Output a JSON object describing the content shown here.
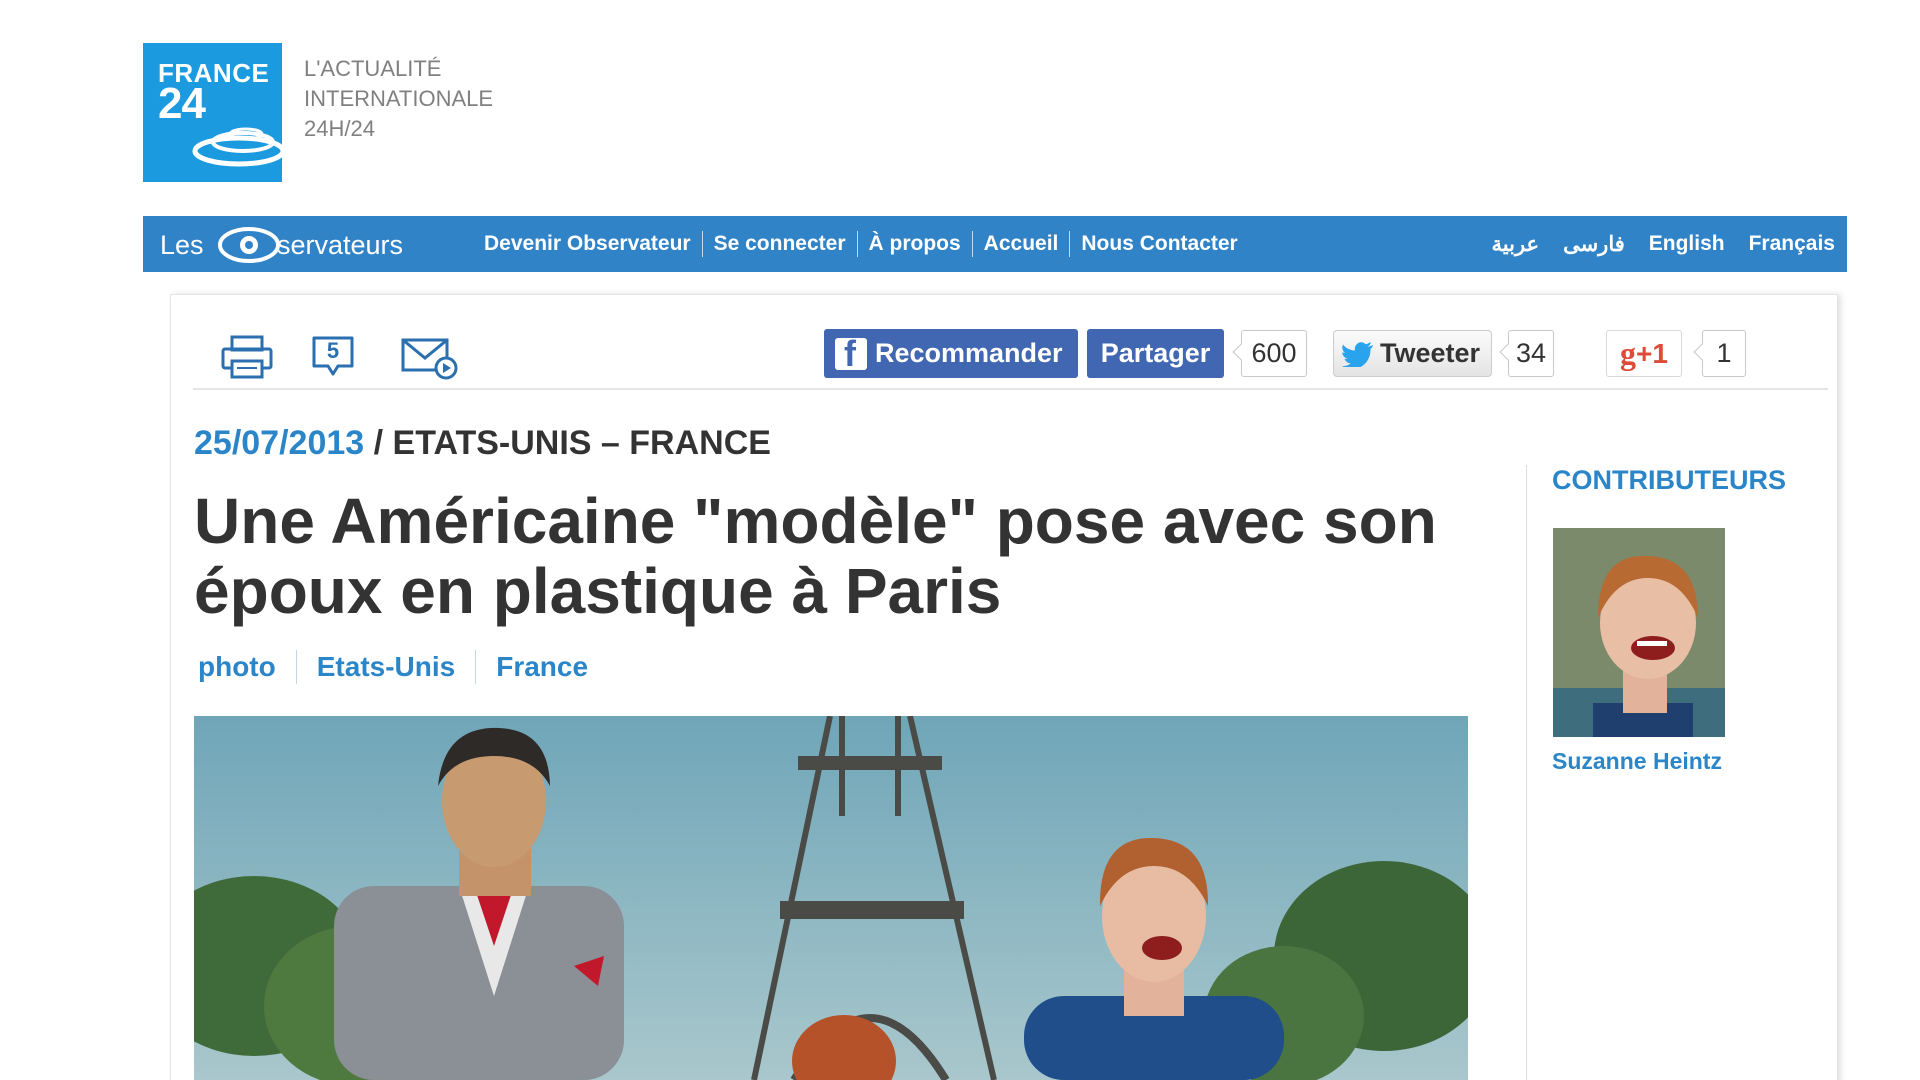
{
  "colors": {
    "brand_blue": "#1b9ae0",
    "nav_blue": "#3183c8",
    "link_blue": "#2a86c9",
    "facebook_blue": "#4267b2",
    "google_red": "#dd4b39"
  },
  "header": {
    "logo": {
      "line1": "FRANCE",
      "line2": "24",
      "icon": "france24-logo"
    },
    "tagline": [
      "L'ACTUALITÉ",
      "INTERNATIONALE",
      "24H/24"
    ]
  },
  "navbar": {
    "brand": {
      "les": "Les",
      "rest": "servateurs",
      "icon": "eye-icon"
    },
    "links": [
      "Devenir Observateur",
      "Se connecter",
      "À propos",
      "Accueil",
      "Nous Contacter"
    ],
    "languages": [
      "عربية",
      "فارسی",
      "English",
      "Français"
    ]
  },
  "toolbar": {
    "icons": [
      "print-icon",
      "comments-icon",
      "email-icon"
    ],
    "comment_count": "5",
    "fb_recommend_label": "Recommander",
    "fb_share_label": "Partager",
    "fb_count": "600",
    "tweet_label": "Tweeter",
    "tweet_count": "34",
    "gplus_label": "+1",
    "gplus_count": "1"
  },
  "article": {
    "date": "25/07/2013",
    "separator": " / ",
    "region": "ETATS-UNIS – FRANCE",
    "headline": "Une Américaine \"modèle\" pose avec son époux en plastique à Paris",
    "tags": [
      "photo",
      "Etats-Unis",
      "France"
    ]
  },
  "sidebar": {
    "title": "CONTRIBUTEURS",
    "contributor_name": "Suzanne Heintz"
  }
}
